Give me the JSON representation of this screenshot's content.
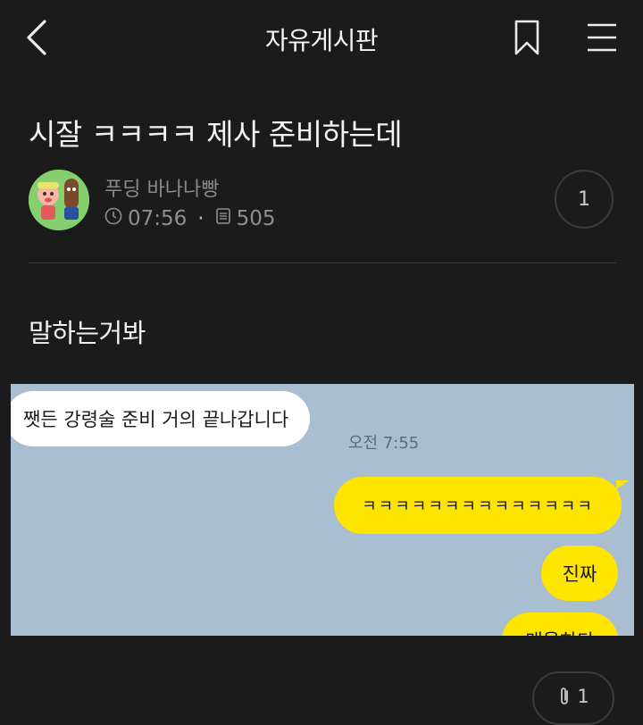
{
  "header": {
    "board_title": "자유게시판",
    "icons": {
      "back": "chevron-left-icon",
      "bookmark": "bookmark-icon",
      "menu": "hamburger-menu-icon"
    }
  },
  "post": {
    "title": "시잘 ㅋㅋㅋㅋ 제사 준비하는데",
    "author": "푸딩 바나나빵",
    "time": "07:56",
    "separator": "·",
    "views": "505",
    "comment_count": "1",
    "body": "말하는거봐"
  },
  "chat_image": {
    "background_color": "#a9bfd1",
    "messages": [
      {
        "side": "left",
        "text": "쨋든 강령술 준비 거의 끝나갑니다",
        "time": "오전 7:55"
      },
      {
        "side": "right",
        "text": "ㅋㅋㅋㅋㅋㅋㅋㅋㅋㅋㅋㅋㅋㅋ"
      },
      {
        "side": "right",
        "text": "진짜"
      },
      {
        "side": "right",
        "text": "매울하다"
      }
    ],
    "bubble_color": "#fee500"
  },
  "footer": {
    "attachment_count": "1",
    "attachment_icon": "paperclip-icon"
  }
}
